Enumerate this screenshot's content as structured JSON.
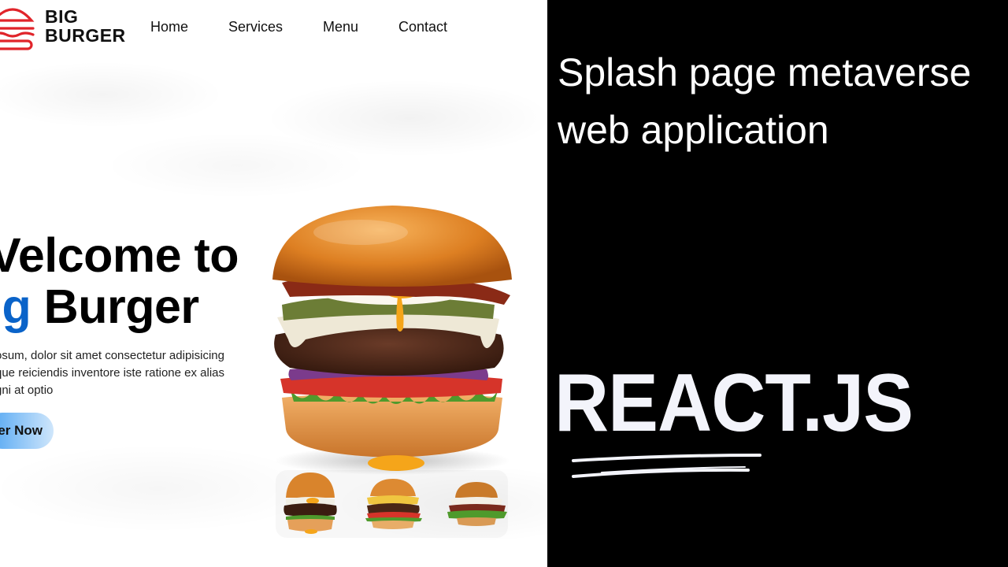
{
  "site": {
    "brand": {
      "line1": "BIG",
      "line2": "BURGER",
      "logo_icon": "burger-logo-icon",
      "logo_color": "#e0242a"
    },
    "nav": [
      {
        "label": "Home"
      },
      {
        "label": "Services"
      },
      {
        "label": "Menu"
      },
      {
        "label": "Contact"
      }
    ],
    "hero": {
      "line1": "Welcome to",
      "line2_accent": "Big",
      "line2_rest": " Burger",
      "visible_line1": "Velcome to",
      "visible_line2_accent": "ig",
      "visible_line2_rest": " Burger",
      "description_lines": [
        "osum, dolor sit amet consectetur adipisicing",
        "que reiciendis inventore iste ratione ex alias",
        "gni at optio"
      ],
      "cta_label": "er Now",
      "accent_color": "#0a63c9"
    },
    "images": {
      "main": "burger-hero-image",
      "thumbnails": [
        "burger-thumb-1",
        "burger-thumb-2",
        "burger-thumb-3"
      ]
    }
  },
  "promo": {
    "title_line1": "Splash page metaverse",
    "title_line2": "web application",
    "tech": "REACT.JS",
    "underline_icon": "brush-underline-icon"
  }
}
